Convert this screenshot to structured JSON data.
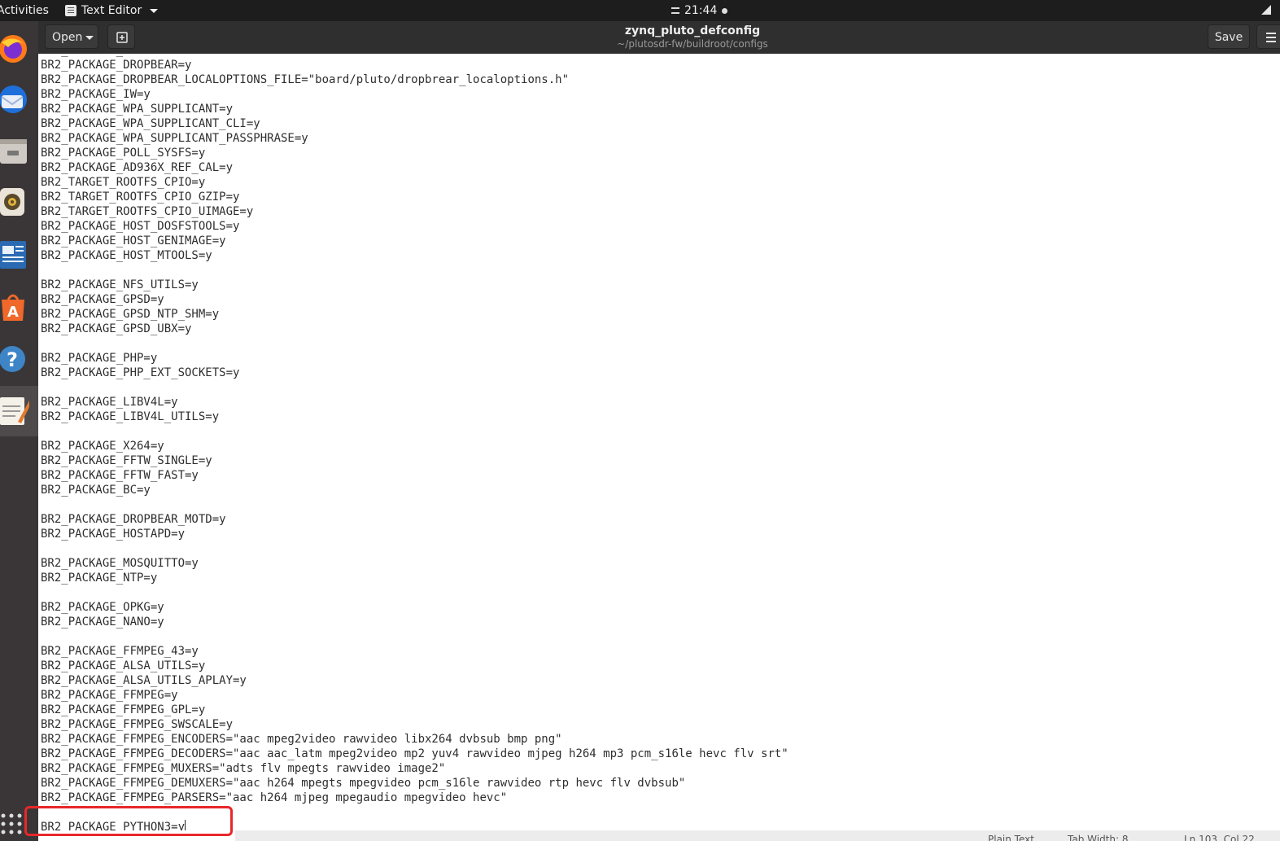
{
  "topbar": {
    "activities": "Activities",
    "app_name": "Text Editor",
    "clock": "21:44"
  },
  "dock": {
    "items": [
      {
        "icon": "firefox-icon"
      },
      {
        "icon": "thunderbird-icon"
      },
      {
        "icon": "files-icon"
      },
      {
        "icon": "rhythmbox-icon"
      },
      {
        "icon": "libreoffice-writer-icon"
      },
      {
        "icon": "software-center-icon"
      },
      {
        "icon": "help-icon"
      },
      {
        "icon": "text-editor-icon"
      },
      {
        "icon": "show-applications-icon"
      }
    ]
  },
  "headerbar": {
    "open_label": "Open",
    "save_label": "Save",
    "title": "zynq_pluto_defconfig",
    "path": "~/plutosdr-fw/buildroot/configs"
  },
  "editor": {
    "lines": [
      "BR2_PACKAGE_...",
      "BR2_PACKAGE_DROPBEAR=y",
      "BR2_PACKAGE_DROPBEAR_LOCALOPTIONS_FILE=\"board/pluto/dropbrear_localoptions.h\"",
      "BR2_PACKAGE_IW=y",
      "BR2_PACKAGE_WPA_SUPPLICANT=y",
      "BR2_PACKAGE_WPA_SUPPLICANT_CLI=y",
      "BR2_PACKAGE_WPA_SUPPLICANT_PASSPHRASE=y",
      "BR2_PACKAGE_POLL_SYSFS=y",
      "BR2_PACKAGE_AD936X_REF_CAL=y",
      "BR2_TARGET_ROOTFS_CPIO=y",
      "BR2_TARGET_ROOTFS_CPIO_GZIP=y",
      "BR2_TARGET_ROOTFS_CPIO_UIMAGE=y",
      "BR2_PACKAGE_HOST_DOSFSTOOLS=y",
      "BR2_PACKAGE_HOST_GENIMAGE=y",
      "BR2_PACKAGE_HOST_MTOOLS=y",
      "",
      "BR2_PACKAGE_NFS_UTILS=y",
      "BR2_PACKAGE_GPSD=y",
      "BR2_PACKAGE_GPSD_NTP_SHM=y",
      "BR2_PACKAGE_GPSD_UBX=y",
      "",
      "BR2_PACKAGE_PHP=y",
      "BR2_PACKAGE_PHP_EXT_SOCKETS=y",
      "",
      "BR2_PACKAGE_LIBV4L=y",
      "BR2_PACKAGE_LIBV4L_UTILS=y",
      "",
      "BR2_PACKAGE_X264=y",
      "BR2_PACKAGE_FFTW_SINGLE=y",
      "BR2_PACKAGE_FFTW_FAST=y",
      "BR2_PACKAGE_BC=y",
      "",
      "BR2_PACKAGE_DROPBEAR_MOTD=y",
      "BR2_PACKAGE_HOSTAPD=y",
      "",
      "BR2_PACKAGE_MOSQUITTO=y",
      "BR2_PACKAGE_NTP=y",
      "",
      "BR2_PACKAGE_OPKG=y",
      "BR2_PACKAGE_NANO=y",
      "",
      "BR2_PACKAGE_FFMPEG_43=y",
      "BR2_PACKAGE_ALSA_UTILS=y",
      "BR2_PACKAGE_ALSA_UTILS_APLAY=y",
      "BR2_PACKAGE_FFMPEG=y",
      "BR2_PACKAGE_FFMPEG_GPL=y",
      "BR2_PACKAGE_FFMPEG_SWSCALE=y",
      "BR2_PACKAGE_FFMPEG_ENCODERS=\"aac mpeg2video rawvideo libx264 dvbsub bmp png\"",
      "BR2_PACKAGE_FFMPEG_DECODERS=\"aac aac_latm mpeg2video mp2 yuv4 rawvideo mjpeg h264 mp3 pcm_s16le hevc flv srt\"",
      "BR2_PACKAGE_FFMPEG_MUXERS=\"adts flv mpegts rawvideo image2\"",
      "BR2_PACKAGE_FFMPEG_DEMUXERS=\"aac h264 mpegts mpegvideo pcm_s16le rawvideo rtp hevc flv dvbsub\"",
      "BR2_PACKAGE_FFMPEG_PARSERS=\"aac h264 mjpeg mpegaudio mpegvideo hevc\"",
      "",
      "BR2_PACKAGE_PYTHON3=y"
    ]
  },
  "statusbar": {
    "language": "Plain Text",
    "tab_width": "Tab Width: 8",
    "position": "Ln 103, Col 22"
  },
  "colors": {
    "highlight": "#e8272a",
    "dock_bg": "#3a3637",
    "headerbar_bg": "#2f2f2f"
  }
}
